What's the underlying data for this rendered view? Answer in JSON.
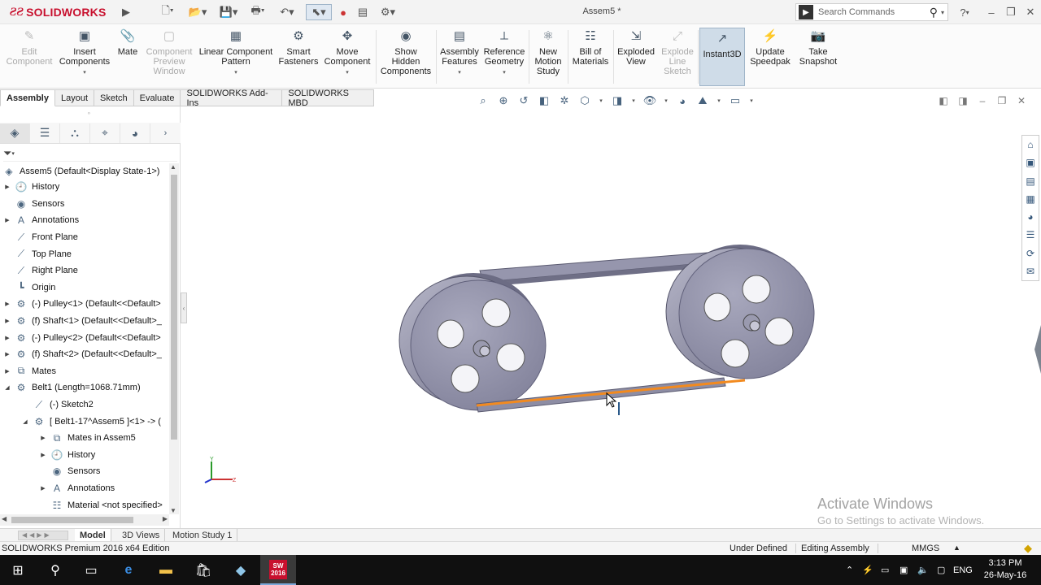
{
  "app": {
    "brand": "SOLIDWORKS",
    "document_title": "Assem5 *",
    "search_placeholder": "Search Commands",
    "help_label": "?"
  },
  "commands": [
    {
      "id": "edit-component",
      "label": "Edit\nComponent",
      "disabled": true,
      "icon": "edit-component-icon"
    },
    {
      "id": "insert-components",
      "label": "Insert\nComponents",
      "disabled": false,
      "icon": "insert-components-icon"
    },
    {
      "id": "mate",
      "label": "Mate",
      "disabled": false,
      "icon": "mate-icon"
    },
    {
      "id": "component-preview",
      "label": "Component\nPreview\nWindow",
      "disabled": true,
      "icon": "preview-window-icon"
    },
    {
      "id": "linear-pattern",
      "label": "Linear Component\nPattern",
      "disabled": false,
      "icon": "linear-pattern-icon"
    },
    {
      "id": "smart-fasteners",
      "label": "Smart\nFasteners",
      "disabled": false,
      "icon": "smart-fasteners-icon"
    },
    {
      "id": "move-component",
      "label": "Move\nComponent",
      "disabled": false,
      "icon": "move-component-icon"
    },
    {
      "id": "show-hidden",
      "label": "Show\nHidden\nComponents",
      "disabled": false,
      "icon": "show-hidden-icon"
    },
    {
      "id": "assembly-features",
      "label": "Assembly\nFeatures",
      "disabled": false,
      "icon": "assembly-features-icon"
    },
    {
      "id": "reference-geometry",
      "label": "Reference\nGeometry",
      "disabled": false,
      "icon": "reference-geometry-icon"
    },
    {
      "id": "new-motion-study",
      "label": "New\nMotion\nStudy",
      "disabled": false,
      "icon": "motion-study-icon"
    },
    {
      "id": "bill-of-materials",
      "label": "Bill of\nMaterials",
      "disabled": false,
      "icon": "bom-icon"
    },
    {
      "id": "exploded-view",
      "label": "Exploded\nView",
      "disabled": false,
      "icon": "exploded-view-icon"
    },
    {
      "id": "explode-line-sketch",
      "label": "Explode\nLine\nSketch",
      "disabled": true,
      "icon": "explode-line-icon"
    },
    {
      "id": "instant3d",
      "label": "Instant3D",
      "disabled": false,
      "active": true,
      "icon": "instant3d-icon"
    },
    {
      "id": "update-speedpak",
      "label": "Update\nSpeedpak",
      "disabled": false,
      "icon": "speedpak-icon"
    },
    {
      "id": "take-snapshot",
      "label": "Take\nSnapshot",
      "disabled": false,
      "icon": "snapshot-icon"
    }
  ],
  "tabs": [
    "Assembly",
    "Layout",
    "Sketch",
    "Evaluate",
    "SOLIDWORKS Add-Ins",
    "SOLIDWORKS MBD"
  ],
  "tree": {
    "root": "Assem5  (Default<Display State-1>)",
    "items": [
      {
        "label": "History",
        "indent": 0,
        "expander": "right"
      },
      {
        "label": "Sensors",
        "indent": 0,
        "expander": ""
      },
      {
        "label": "Annotations",
        "indent": 0,
        "expander": "right"
      },
      {
        "label": "Front Plane",
        "indent": 0,
        "expander": ""
      },
      {
        "label": "Top Plane",
        "indent": 0,
        "expander": ""
      },
      {
        "label": "Right Plane",
        "indent": 0,
        "expander": ""
      },
      {
        "label": "Origin",
        "indent": 0,
        "expander": ""
      },
      {
        "label": "(-) Pulley<1> (Default<<Default>",
        "indent": 0,
        "expander": "right"
      },
      {
        "label": "(f) Shaft<1> (Default<<Default>_",
        "indent": 0,
        "expander": "right"
      },
      {
        "label": "(-) Pulley<2> (Default<<Default>",
        "indent": 0,
        "expander": "right"
      },
      {
        "label": "(f) Shaft<2> (Default<<Default>_",
        "indent": 0,
        "expander": "right"
      },
      {
        "label": "Mates",
        "indent": 0,
        "expander": "right"
      },
      {
        "label": "Belt1 (Length=1068.71mm)",
        "indent": 0,
        "expander": "down"
      },
      {
        "label": "(-) Sketch2",
        "indent": 1,
        "expander": ""
      },
      {
        "label": "[ Belt1-17^Assem5 ]<1> -> (",
        "indent": 1,
        "expander": "down"
      },
      {
        "label": "Mates in Assem5",
        "indent": 2,
        "expander": "right"
      },
      {
        "label": "History",
        "indent": 2,
        "expander": "right"
      },
      {
        "label": "Sensors",
        "indent": 2,
        "expander": ""
      },
      {
        "label": "Annotations",
        "indent": 2,
        "expander": "right"
      },
      {
        "label": "Material <not specified>",
        "indent": 2,
        "expander": ""
      }
    ]
  },
  "activation": {
    "title": "Activate Windows",
    "subtitle": "Go to Settings to activate Windows."
  },
  "bottom_tabs": [
    "Model",
    "3D Views",
    "Motion Study 1"
  ],
  "status": {
    "edition": "SOLIDWORKS Premium 2016 x64 Edition",
    "definition": "Under Defined",
    "mode": "Editing Assembly",
    "units": "MMGS"
  },
  "taskbar": {
    "language": "ENG",
    "time": "3:13 PM",
    "date": "26-May-16",
    "app_badge": "SW 2016"
  },
  "colors": {
    "brand": "#c8102e",
    "belt_highlight": "#f28a1f",
    "pulley": "#8a8aa3"
  }
}
